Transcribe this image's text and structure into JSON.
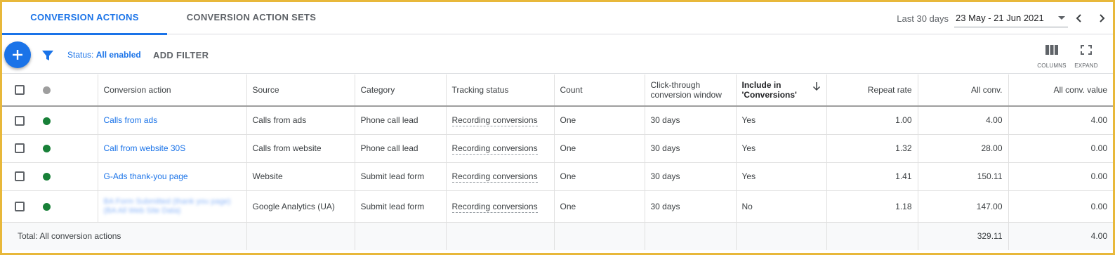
{
  "tabs": [
    {
      "label": "CONVERSION ACTIONS",
      "active": true
    },
    {
      "label": "CONVERSION ACTION SETS",
      "active": false
    }
  ],
  "date_range": {
    "label": "Last 30 days",
    "value": "23 May - 21 Jun 2021"
  },
  "filter": {
    "status_prefix": "Status:",
    "status_value": "All enabled",
    "add_filter_label": "ADD FILTER"
  },
  "toolbar": {
    "columns_label": "COLUMNS",
    "expand_label": "EXPAND"
  },
  "table": {
    "headers": {
      "conversion_action": "Conversion action",
      "source": "Source",
      "category": "Category",
      "tracking_status": "Tracking status",
      "count": "Count",
      "click_through": "Click-through conversion window",
      "include": "Include in 'Conversions'",
      "repeat_rate": "Repeat rate",
      "all_conv": "All conv.",
      "all_conv_value": "All conv. value"
    },
    "rows": [
      {
        "name": "Calls from ads",
        "source": "Calls from ads",
        "category": "Phone call lead",
        "tracking": "Recording conversions",
        "count": "One",
        "window": "30 days",
        "include": "Yes",
        "repeat_rate": "1.00",
        "all_conv": "4.00",
        "all_conv_value": "4.00"
      },
      {
        "name": "Call from website 30S",
        "source": "Calls from website",
        "category": "Phone call lead",
        "tracking": "Recording conversions",
        "count": "One",
        "window": "30 days",
        "include": "Yes",
        "repeat_rate": "1.32",
        "all_conv": "28.00",
        "all_conv_value": "0.00"
      },
      {
        "name": "G-Ads thank-you page",
        "source": "Website",
        "category": "Submit lead form",
        "tracking": "Recording conversions",
        "count": "One",
        "window": "30 days",
        "include": "Yes",
        "repeat_rate": "1.41",
        "all_conv": "150.11",
        "all_conv_value": "0.00"
      },
      {
        "name": "BA Form Submitted (thank you page) (BA All Web Site Data)",
        "source": "Google Analytics (UA)",
        "category": "Submit lead form",
        "tracking": "Recording conversions",
        "count": "One",
        "window": "30 days",
        "include": "No",
        "repeat_rate": "1.18",
        "all_conv": "147.00",
        "all_conv_value": "0.00"
      }
    ],
    "total": {
      "label": "Total: All conversion actions",
      "all_conv": "329.11",
      "all_conv_value": "4.00"
    }
  },
  "colors": {
    "accent": "#1a73e8",
    "enabled_dot": "#188038",
    "header_dot": "#9e9e9e",
    "frame": "#e8b83a"
  },
  "icons": {
    "add": "plus-icon",
    "filter": "filter-funnel-icon",
    "prev": "chevron-left-icon",
    "next": "chevron-right-icon",
    "dropdown": "caret-down-icon",
    "columns": "columns-icon",
    "expand": "expand-icon",
    "sort": "arrow-down-icon"
  }
}
